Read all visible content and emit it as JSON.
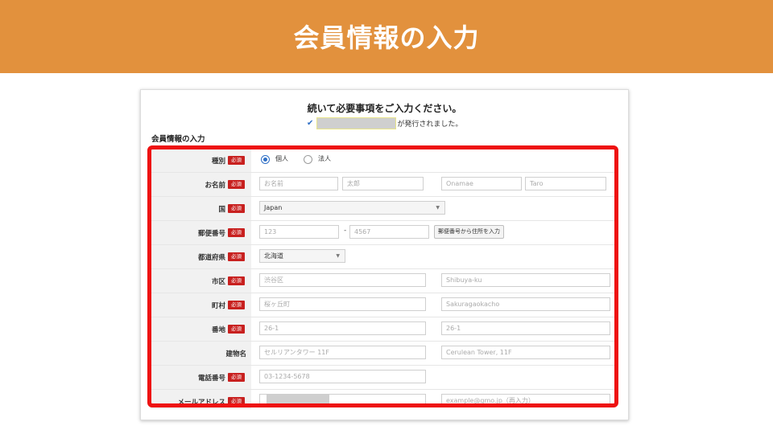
{
  "banner": {
    "title": "会員情報の入力"
  },
  "page": {
    "heading": "続いて必要事項をご入力ください。",
    "notice_suffix": "が発行されました。",
    "section_title": "会員情報の入力"
  },
  "required_badge": "必須",
  "form": {
    "type": {
      "label": "種別",
      "options": [
        "個人",
        "法人"
      ],
      "selected": "個人"
    },
    "name": {
      "label": "お名前",
      "family_placeholder": "お名前",
      "given_placeholder": "太郎",
      "family_roman_placeholder": "Onamae",
      "given_roman_placeholder": "Taro"
    },
    "country": {
      "label": "国",
      "value": "Japan"
    },
    "postal": {
      "label": "郵便番号",
      "part1_placeholder": "123",
      "separator": "-",
      "part2_placeholder": "4567",
      "lookup_button": "郵便番号から住所を入力"
    },
    "prefecture": {
      "label": "都道府県",
      "value": "北海道"
    },
    "city": {
      "label": "市区",
      "placeholder": "渋谷区",
      "roman_placeholder": "Shibuya-ku"
    },
    "town": {
      "label": "町村",
      "placeholder": "桜ヶ丘町",
      "roman_placeholder": "Sakuragaokacho"
    },
    "street": {
      "label": "番地",
      "placeholder": "26-1",
      "roman_placeholder": "26-1"
    },
    "building": {
      "label": "建物名",
      "placeholder": "セルリアンタワー 11F",
      "roman_placeholder": "Cerulean Tower, 11F"
    },
    "phone": {
      "label": "電話番号",
      "placeholder": "03-1234-5678"
    },
    "email": {
      "label": "メールアドレス",
      "confirm_placeholder": "example@gmo.jp（再入力）"
    }
  },
  "colors": {
    "banner": "#e2913d",
    "highlight_frame": "#ee1111",
    "required_badge": "#c8201f",
    "accent": "#2f6fc6"
  }
}
